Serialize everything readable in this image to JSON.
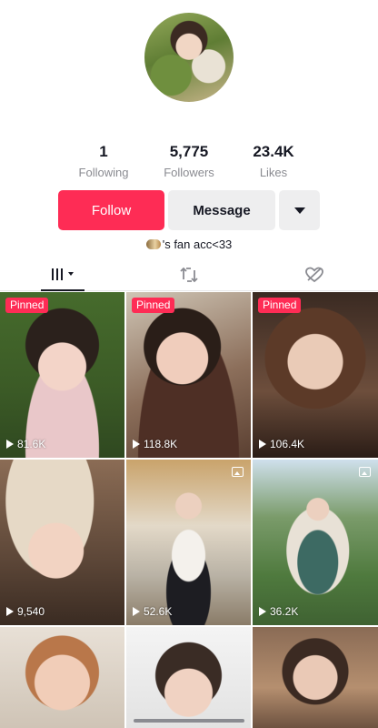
{
  "profile": {
    "stats": [
      {
        "value": "1",
        "label": "Following"
      },
      {
        "value": "5,775",
        "label": "Followers"
      },
      {
        "value": "23.4K",
        "label": "Likes"
      }
    ],
    "follow_label": "Follow",
    "message_label": "Message",
    "bio": "'s fan acc<33"
  },
  "colors": {
    "accent": "#fe2c55",
    "secondary_btn": "#eeeeef",
    "text": "#161823",
    "muted": "#8a8b91"
  },
  "tabs": [
    {
      "icon": "grid-icon",
      "active": true
    },
    {
      "icon": "repost-icon",
      "active": false
    },
    {
      "icon": "liked-icon",
      "active": false
    }
  ],
  "videos": [
    {
      "pinned_label": "Pinned",
      "views": "81.6K"
    },
    {
      "pinned_label": "Pinned",
      "views": "118.8K"
    },
    {
      "pinned_label": "Pinned",
      "views": "106.4K"
    },
    {
      "views": "9,540"
    },
    {
      "views": "52.6K",
      "photo": true
    },
    {
      "views": "36.2K",
      "photo": true
    },
    {
      "views": ""
    },
    {
      "views": ""
    },
    {
      "views": ""
    }
  ]
}
